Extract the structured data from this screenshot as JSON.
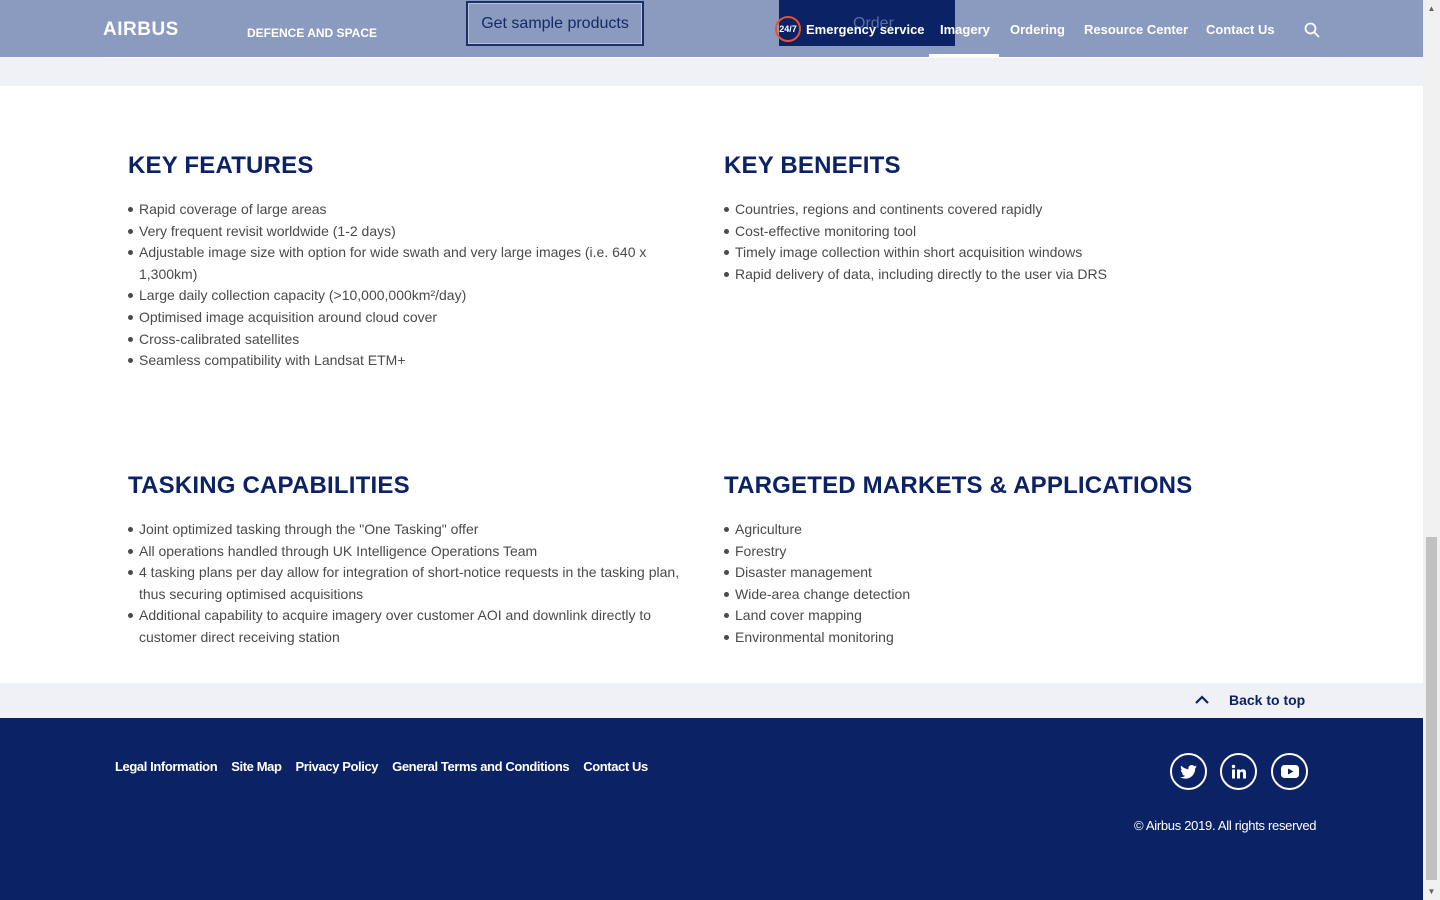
{
  "header": {
    "logo": "AIRBUS",
    "division": "DEFENCE AND SPACE",
    "sample_button": "Get sample products",
    "order_button": "Order",
    "emergency_badge": "24/7",
    "emergency_label": "Emergency service",
    "nav": [
      "Imagery",
      "Ordering",
      "Resource Center",
      "Contact Us"
    ],
    "active_nav": "Imagery",
    "search_icon": "search-icon"
  },
  "sections": {
    "key_features": {
      "title": "KEY FEATURES",
      "items": [
        "Rapid coverage of large areas",
        "Very frequent revisit worldwide (1-2 days)",
        "Adjustable image size with option for wide swath and very large images (i.e. 640 x 1,300km)",
        "Large daily collection capacity (>10,000,000km²/day)",
        "Optimised image acquisition around cloud cover",
        "Cross-calibrated satellites",
        "Seamless compatibility with Landsat ETM+"
      ]
    },
    "key_benefits": {
      "title": "KEY BENEFITS",
      "items": [
        "Countries, regions and continents covered rapidly",
        "Cost-effective monitoring tool",
        "Timely image collection within short acquisition windows",
        "Rapid delivery of data, including directly to the user via DRS"
      ]
    },
    "tasking": {
      "title": "TASKING CAPABILITIES",
      "items": [
        "Joint optimized tasking through the \"One Tasking\" offer",
        "All operations handled through UK Intelligence Operations Team",
        "4 tasking plans per day allow for integration of short-notice requests in the tasking plan, thus securing optimised acquisitions",
        "Additional capability to acquire imagery over customer AOI and downlink directly to customer direct receiving station"
      ]
    },
    "markets": {
      "title": "TARGETED MARKETS & APPLICATIONS",
      "items": [
        "Agriculture",
        "Forestry",
        "Disaster management",
        "Wide-area change detection",
        "Land cover mapping",
        "Environmental monitoring"
      ]
    }
  },
  "back_to_top": "Back to top",
  "footer": {
    "links": [
      "Legal Information",
      "Site Map",
      "Privacy Policy",
      "General Terms and Conditions",
      "Contact Us"
    ],
    "social": [
      "twitter-icon",
      "linkedin-icon",
      "youtube-icon"
    ],
    "copyright": "© Airbus 2019. All rights reserved"
  },
  "colors": {
    "header_bg": "#8a9bbf",
    "brand_navy": "#0b2265",
    "emergency_accent": "#e8542a",
    "band_bg": "#eff1f7"
  }
}
